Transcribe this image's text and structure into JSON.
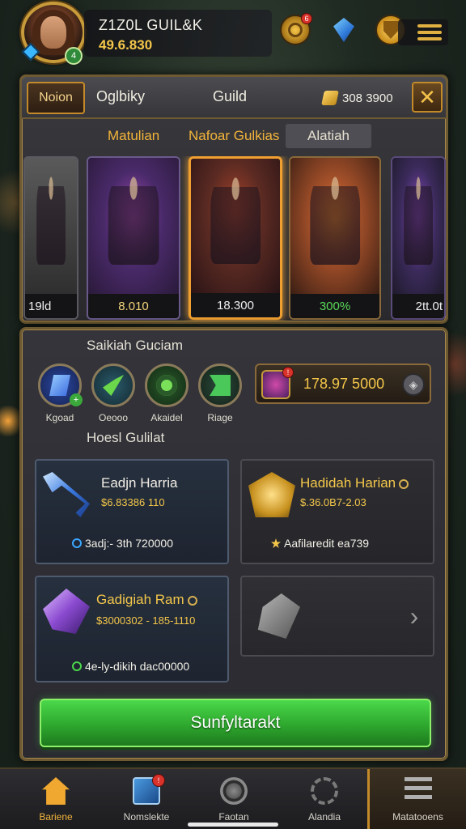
{
  "player": {
    "name": "Z1Z0L GUIL&K",
    "gold": "49.6.830",
    "level_badge": "4"
  },
  "top_icons": {
    "compass_notification": "6"
  },
  "guild_panel": {
    "tab_active": "Noion",
    "tab_1": "Oglbiky",
    "tab_2": "Guild",
    "currency_value": "308 3900",
    "close_label": "✕",
    "subtabs": [
      "Matulian",
      "Nafoar Gulkias",
      "Alatiah"
    ],
    "heroes": [
      {
        "label": "19ld"
      },
      {
        "label": "8.010"
      },
      {
        "label": "18.300"
      },
      {
        "label": "300%"
      },
      {
        "label": "2tt.0t"
      }
    ]
  },
  "lower_panel": {
    "section_1_title": "Saikiah Guciam",
    "skills": [
      {
        "label": "Kgoad"
      },
      {
        "label": "Oeooo"
      },
      {
        "label": "Akaidel"
      },
      {
        "label": "Riage"
      }
    ],
    "resource_value": "178.97 5000",
    "resource_notification": "!",
    "section_2_title": "Hoesl Gulilat",
    "items": [
      {
        "name": "Eadjn Harria",
        "price": "$6.83386 110",
        "stat": "3adj:- 3th 720000"
      },
      {
        "name": "Hadidah Harian",
        "price": "$.36.0B7-2.03",
        "stat": "Aafilaredit ea739"
      },
      {
        "name": "Gadigiah Ram",
        "price": "$3000302 - 185-1110",
        "stat": "4e-ly-dikih dac00000"
      }
    ],
    "main_button": "Sunfyltarakt"
  },
  "bottom_nav": {
    "items": [
      {
        "label": "Bariene"
      },
      {
        "label": "Nomslekte",
        "badge": "!"
      },
      {
        "label": "Faotan"
      },
      {
        "label": "Alandia"
      },
      {
        "label": "Matatooens"
      }
    ]
  },
  "colors": {
    "accent_gold": "#f4c74a",
    "frame_bronze": "#6e5a32",
    "button_green": "#2ea82e",
    "notification_red": "#d8322a"
  }
}
